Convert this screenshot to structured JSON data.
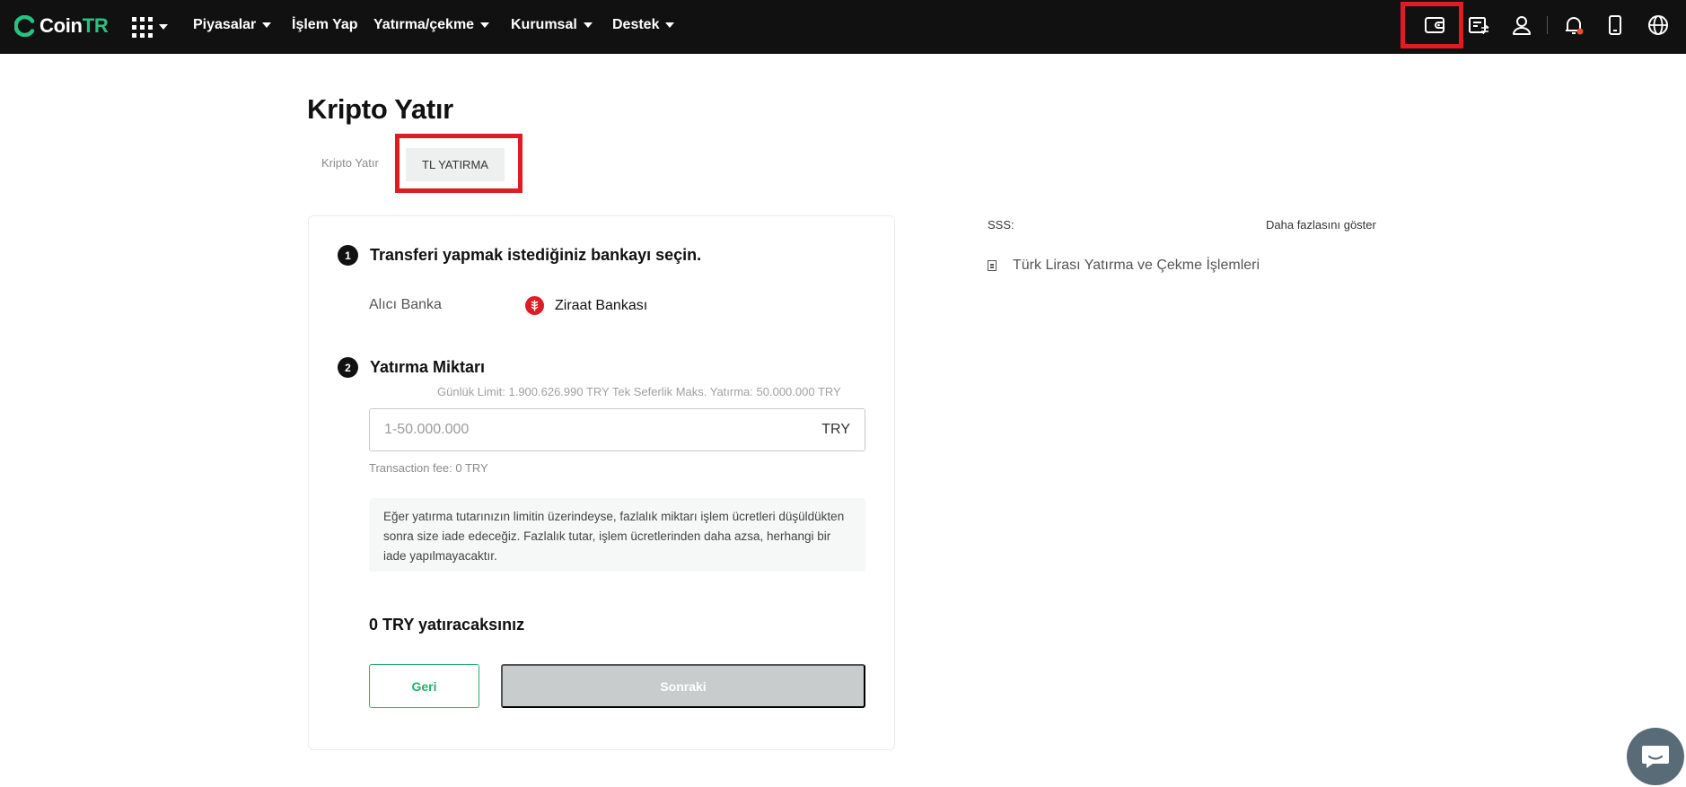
{
  "header": {
    "logo_main": "Coin",
    "logo_accent": "TR",
    "nav": [
      {
        "label": "Piyasalar",
        "dropdown": true
      },
      {
        "label": "İşlem Yap",
        "dropdown": false
      },
      {
        "label": "Yatırma/çekme",
        "dropdown": true
      },
      {
        "label": "Kurumsal",
        "dropdown": true
      },
      {
        "label": "Destek",
        "dropdown": true
      }
    ],
    "icons": [
      "wallet-icon",
      "orders-icon",
      "user-icon",
      "bell-icon",
      "mobile-icon",
      "globe-icon"
    ],
    "notification_dot_color": "#e8502a"
  },
  "page": {
    "title": "Kripto Yatır",
    "tabs": [
      {
        "label": "Kripto Yatır",
        "active": false
      },
      {
        "label": "TL YATIRMA",
        "active": true
      }
    ]
  },
  "step1": {
    "number": "1",
    "title": "Transferi yapmak istediğiniz bankayı seçin.",
    "receiver_label": "Alıcı Banka",
    "bank_name": "Ziraat Bankası"
  },
  "step2": {
    "number": "2",
    "title": "Yatırma Miktarı",
    "limit_text": "Günlük Limit: 1.900.626.990 TRY Tek Seferlik Maks. Yatırma: 50.000.000 TRY",
    "amount_placeholder": "1-50.000.000",
    "amount_value": "",
    "currency": "TRY",
    "fee_text": "Transaction fee: 0 TRY",
    "note": "Eğer yatırma tutarınızın limitin üzerindeyse, fazlalık miktarı işlem ücretleri düşüldükten sonra size iade edeceğiz. Fazlalık tutar, işlem ücretlerinden daha azsa, herhangi bir iade yapılmayacaktır."
  },
  "summary": "0 TRY yatıracaksınız",
  "buttons": {
    "back": "Geri",
    "next": "Sonraki"
  },
  "faq": {
    "label": "SSS:",
    "more": "Daha fazlasını göster",
    "items": [
      "Türk Lirası Yatırma ve Çekme İşlemleri"
    ]
  },
  "colors": {
    "brand_green": "#26b06a",
    "highlight_red": "#e01b24",
    "topbar": "#111111"
  }
}
